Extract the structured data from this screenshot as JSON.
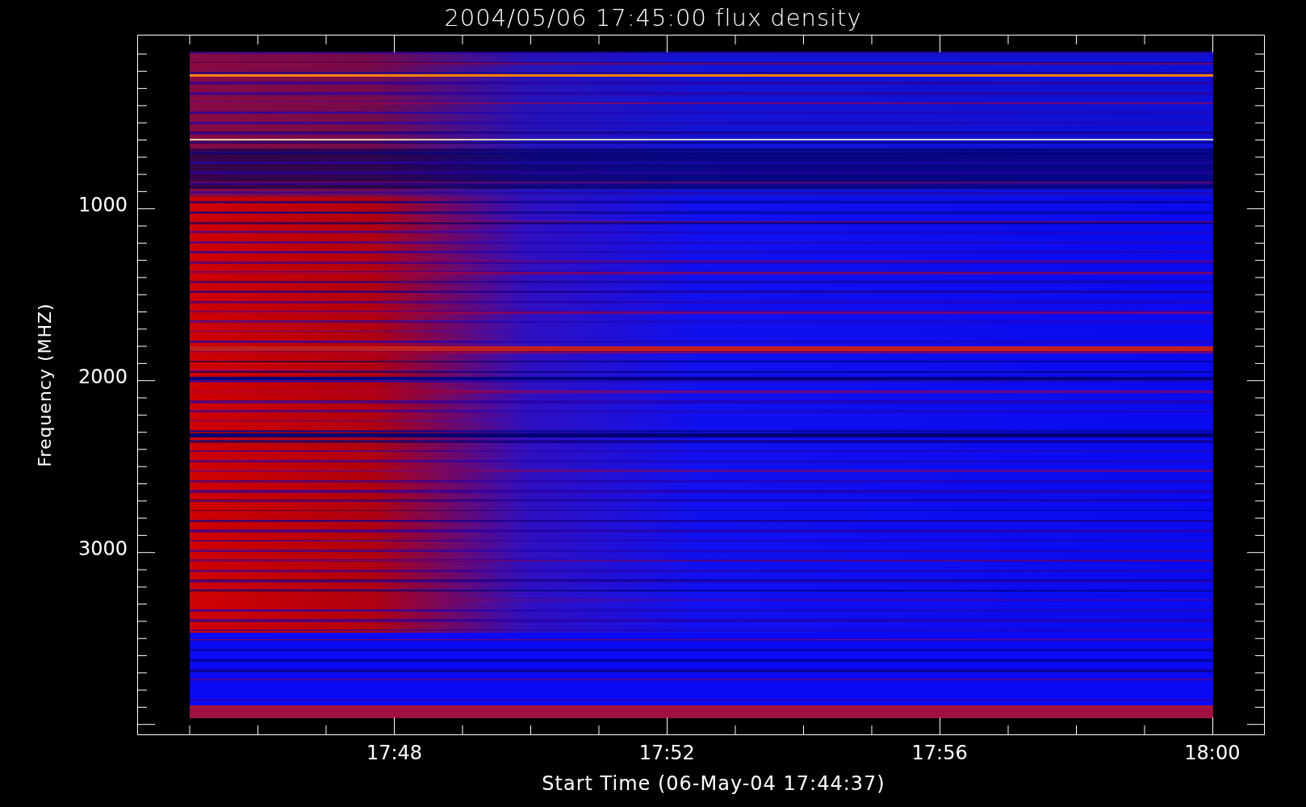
{
  "title": "2004/05/06 17:45:00 flux density",
  "y_axis": {
    "label": "Frequency (MHZ)",
    "ticks": [
      "1000",
      "2000",
      "3000"
    ]
  },
  "x_axis": {
    "label": "Start Time (06-May-04 17:44:37)",
    "ticks": [
      "17:48",
      "17:52",
      "17:56",
      "18:00"
    ]
  }
}
